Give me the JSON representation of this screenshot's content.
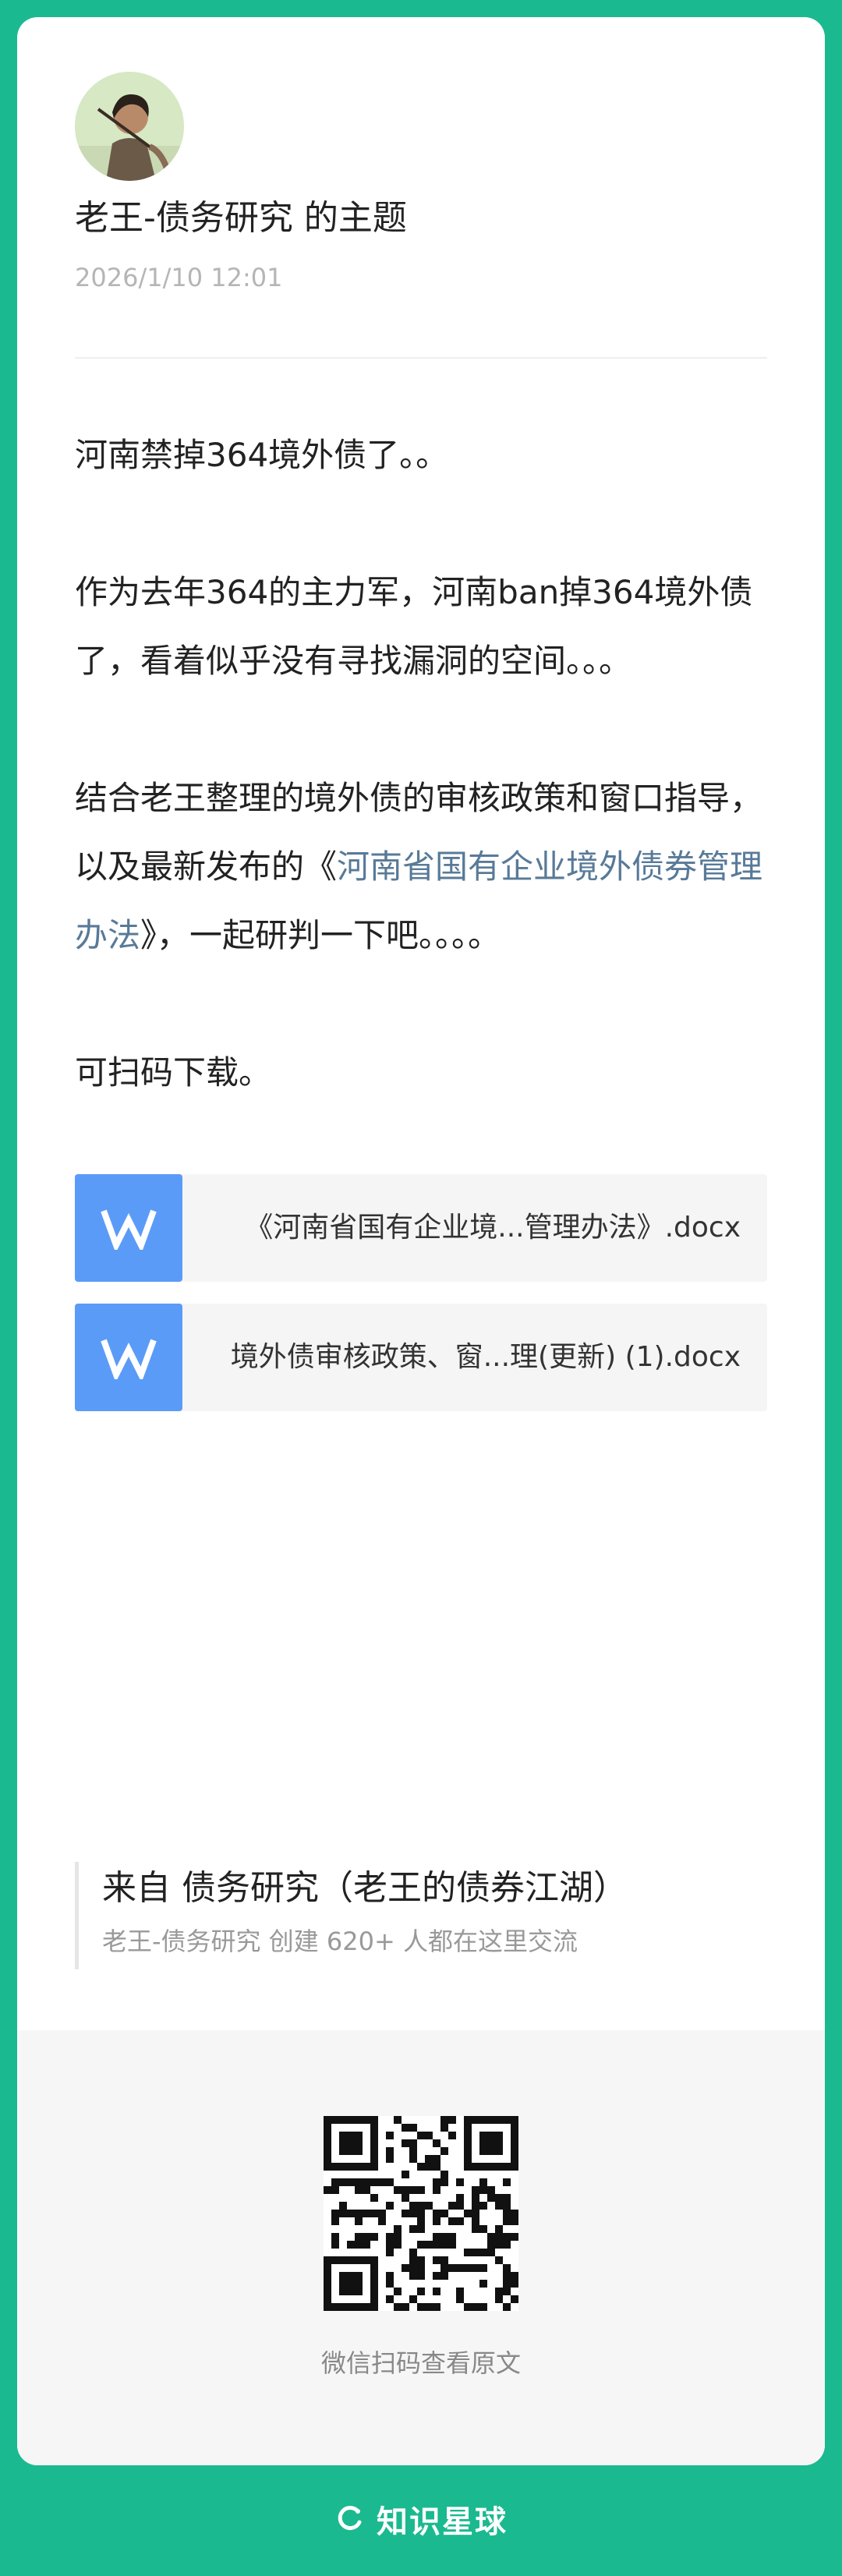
{
  "post": {
    "author_line": "老王-债务研究 的主题",
    "date": "2026/1/10 12:01",
    "paragraphs": {
      "p1": "河南禁掉364境外债了。。",
      "p2": "作为去年364的主力军，河南ban掉364境外债了，看着似乎没有寻找漏洞的空间。。。",
      "p3_before": "结合老王整理的境外债的审核政策和窗口指导，以及最新发布的《",
      "p3_link": "河南省国有企业境外债券管理办法",
      "p3_after": "》，一起研判一下吧。。。。",
      "p4": "可扫码下载。"
    }
  },
  "files": [
    {
      "name": "《河南省国有企业境...管理办法》.docx",
      "icon": "wps-writer-icon"
    },
    {
      "name": "境外债审核政策、窗...理(更新) (1).docx",
      "icon": "wps-writer-icon"
    }
  ],
  "source": {
    "title": "来自 债务研究（老王的债券江湖）",
    "subtitle": "老王-债务研究 创建 620+ 人都在这里交流"
  },
  "qr": {
    "caption": "微信扫码查看原文"
  },
  "footer": {
    "brand": "知识星球"
  },
  "colors": {
    "background": "#1bb98f",
    "link": "#587a98",
    "file_icon": "#5b9bf8"
  }
}
